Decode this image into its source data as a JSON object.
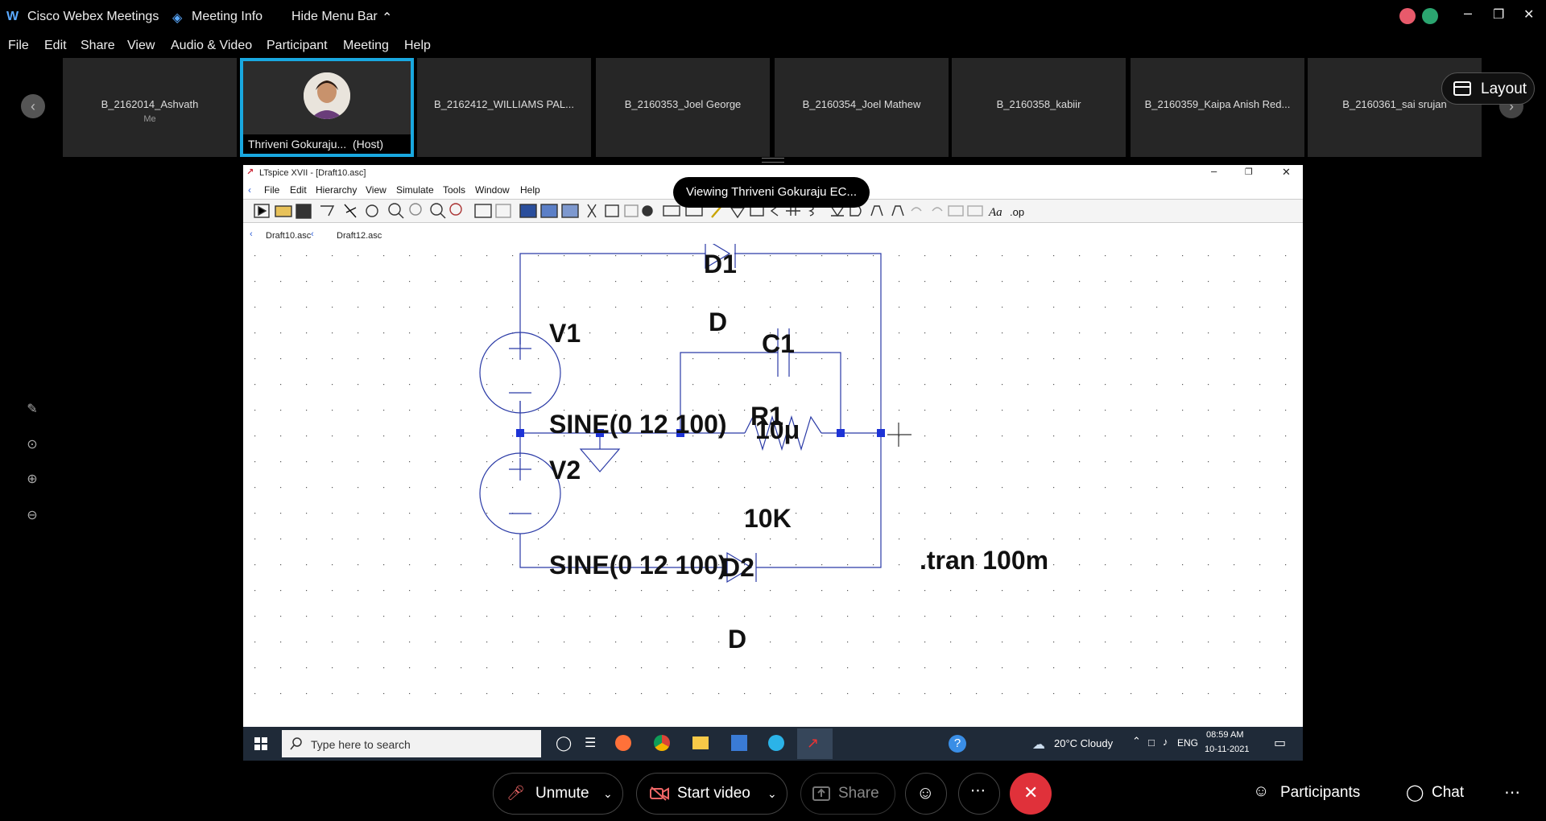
{
  "app": {
    "title": "Cisco Webex Meetings",
    "meeting_info": "Meeting Info",
    "hide_menu": "Hide Menu Bar"
  },
  "menu": [
    "File",
    "Edit",
    "Share",
    "View",
    "Audio & Video",
    "Participant",
    "Meeting",
    "Help"
  ],
  "participants": [
    {
      "name": "B_2162014_Ashvath",
      "sub": "Me"
    },
    {
      "name": "Thriveni Gokuraju...",
      "role": "(Host)"
    },
    {
      "name": "B_2162412_WILLIAMS PAL..."
    },
    {
      "name": "B_2160353_Joel George"
    },
    {
      "name": "B_2160354_Joel Mathew"
    },
    {
      "name": "B_2160358_kabiir"
    },
    {
      "name": "B_2160359_Kaipa Anish Red..."
    },
    {
      "name": "B_2160361_sai srujan"
    }
  ],
  "layout_label": "Layout",
  "viewing_label": "Viewing Thriveni Gokuraju EC...",
  "ltspice": {
    "title": "LTspice XVII - [Draft10.asc]",
    "menu": [
      "File",
      "Edit",
      "Hierarchy",
      "View",
      "Simulate",
      "Tools",
      "Window",
      "Help"
    ],
    "tabs": [
      "Draft10.asc",
      "Draft12.asc"
    ],
    "labels": {
      "D1": "D1",
      "D1_model": "D",
      "C1": "C1",
      "C1_value": "10μ",
      "R1": "R1",
      "R1_value": "10K",
      "V1": "V1",
      "V1_value": "SINE(0 12 100)",
      "V2": "V2",
      "V2_value": "SINE(0 12 100)",
      "D2": "D2",
      "D2_model": "D",
      "tran": ".tran 100m"
    }
  },
  "taskbar": {
    "search_placeholder": "Type here to search",
    "weather": "20°C  Cloudy",
    "lang": "ENG",
    "time": "08:59 AM",
    "date": "10-11-2021"
  },
  "controls": {
    "unmute": "Unmute",
    "start_video": "Start video",
    "share": "Share",
    "participants": "Participants",
    "chat": "Chat"
  }
}
